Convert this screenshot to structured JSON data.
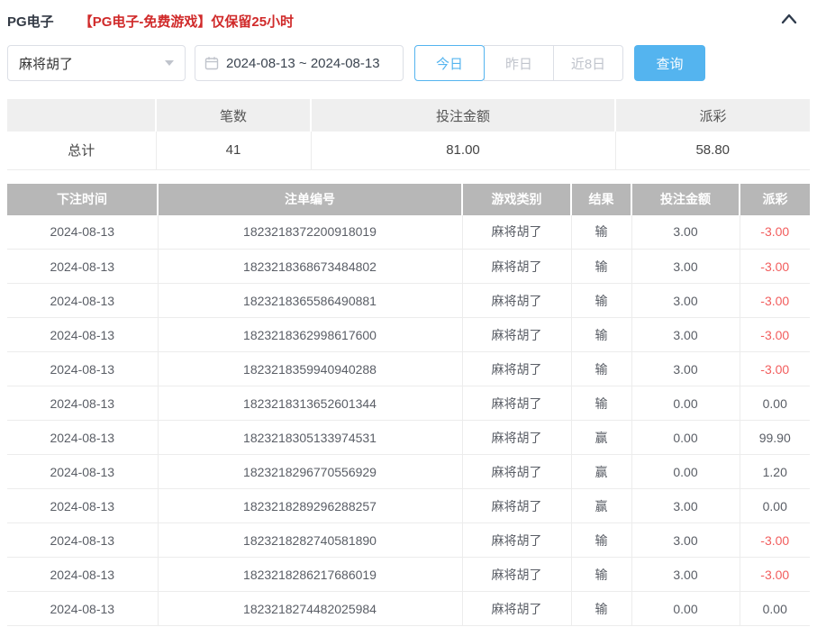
{
  "header": {
    "title": "PG电子",
    "notice": "【PG电子-免费游戏】仅保留25小时"
  },
  "filters": {
    "game_select": {
      "value": "麻将胡了"
    },
    "date_range": {
      "value": "2024-08-13 ~ 2024-08-13"
    },
    "quick_buttons": [
      {
        "label": "今日",
        "active": true
      },
      {
        "label": "昨日",
        "active": false
      },
      {
        "label": "近8日",
        "active": false
      }
    ],
    "search_label": "查询"
  },
  "summary": {
    "columns": [
      "",
      "笔数",
      "投注金额",
      "派彩"
    ],
    "total": {
      "label": "总计",
      "count": "41",
      "bet_amount": "81.00",
      "payout": "58.80"
    }
  },
  "table": {
    "columns": [
      "下注时间",
      "注单编号",
      "游戏类别",
      "结果",
      "投注金额",
      "派彩"
    ],
    "column_keys": [
      "bet-time",
      "order-no",
      "game-type",
      "result",
      "bet-amount",
      "payout"
    ],
    "rows": [
      [
        "2024-08-13",
        "1823218372200918019",
        "麻将胡了",
        "输",
        "3.00",
        "-3.00"
      ],
      [
        "2024-08-13",
        "1823218368673484802",
        "麻将胡了",
        "输",
        "3.00",
        "-3.00"
      ],
      [
        "2024-08-13",
        "1823218365586490881",
        "麻将胡了",
        "输",
        "3.00",
        "-3.00"
      ],
      [
        "2024-08-13",
        "1823218362998617600",
        "麻将胡了",
        "输",
        "3.00",
        "-3.00"
      ],
      [
        "2024-08-13",
        "1823218359940940288",
        "麻将胡了",
        "输",
        "3.00",
        "-3.00"
      ],
      [
        "2024-08-13",
        "1823218313652601344",
        "麻将胡了",
        "输",
        "0.00",
        "0.00"
      ],
      [
        "2024-08-13",
        "1823218305133974531",
        "麻将胡了",
        "赢",
        "0.00",
        "99.90"
      ],
      [
        "2024-08-13",
        "1823218296770556929",
        "麻将胡了",
        "赢",
        "0.00",
        "1.20"
      ],
      [
        "2024-08-13",
        "1823218289296288257",
        "麻将胡了",
        "赢",
        "3.00",
        "0.00"
      ],
      [
        "2024-08-13",
        "1823218282740581890",
        "麻将胡了",
        "输",
        "3.00",
        "-3.00"
      ],
      [
        "2024-08-13",
        "1823218286217686019",
        "麻将胡了",
        "输",
        "3.00",
        "-3.00"
      ],
      [
        "2024-08-13",
        "1823218274482025984",
        "麻将胡了",
        "输",
        "0.00",
        "0.00"
      ]
    ]
  },
  "colors": {
    "accent_blue": "#54b4ef",
    "notice_red": "#d02a2a",
    "negative_red": "#f25d5d",
    "table_header_gray": "#b7b7b7",
    "summary_header_gray": "#efefef"
  }
}
